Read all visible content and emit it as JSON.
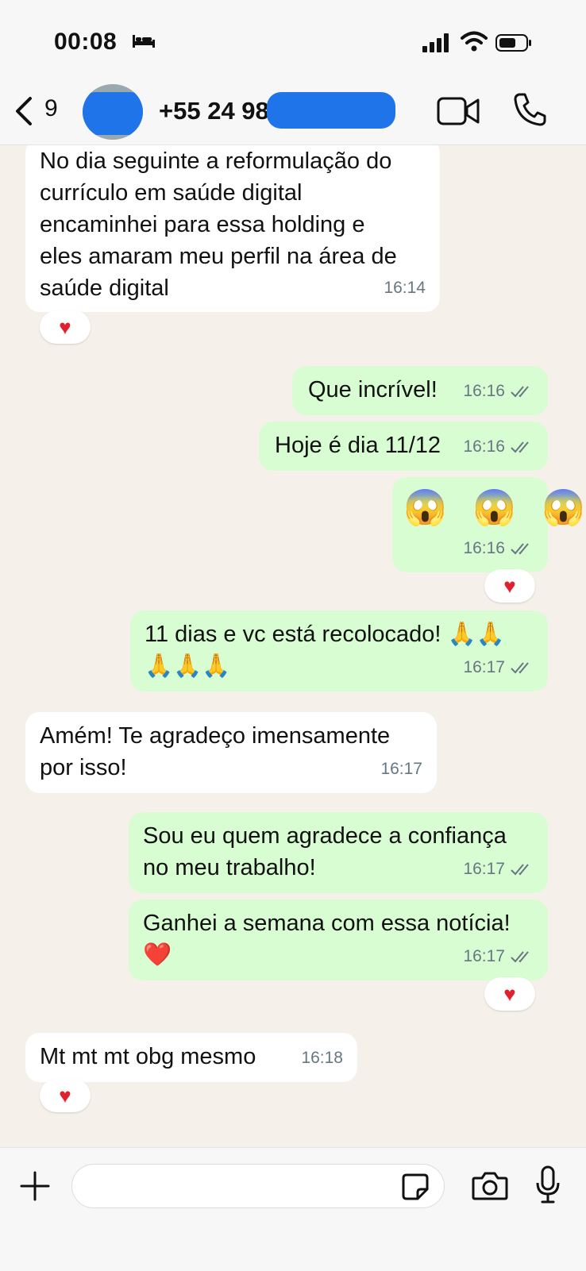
{
  "status_bar": {
    "time": "00:08"
  },
  "header": {
    "unread_count": "9",
    "contact_name": "+55 24 98"
  },
  "messages": [
    {
      "text": "No dia seguinte a reformulação do\ncurrículo em saúde digital\nencaminhei para essa holding e\neles amaram meu perfil na área de\nsaúde digital",
      "time": "16:14",
      "reaction": "♥"
    },
    {
      "text": "Que incrível!",
      "time": "16:16"
    },
    {
      "text": "Hoje é dia 11/12",
      "time": "16:16"
    },
    {
      "text": "😱 😱 😱",
      "time": "16:16",
      "reaction": "♥"
    },
    {
      "text": "11 dias e vc está recolocado! 🙏🙏\n🙏🙏🙏",
      "time": "16:17"
    },
    {
      "text": "Amém! Te agradeço imensamente\npor isso!",
      "time": "16:17"
    },
    {
      "text": "Sou eu quem agradece a confiança\nno meu trabalho!",
      "time": "16:17"
    },
    {
      "text": "Ganhei a semana com essa notícia!\n❤️",
      "time": "16:17",
      "reaction": "♥"
    },
    {
      "text": "Mt mt mt obg mesmo",
      "time": "16:18",
      "reaction": "♥"
    }
  ],
  "composer": {
    "placeholder": ""
  },
  "colors": {
    "outgoing_bubble": "#d9fdd3",
    "incoming_bubble": "#ffffff",
    "background": "#f5f1ea",
    "redaction": "#1e74e8"
  },
  "icons": [
    "bed-icon",
    "signal-icon",
    "wifi-icon",
    "battery-icon",
    "back-chevron-icon",
    "video-call-icon",
    "phone-icon",
    "plus-icon",
    "sticker-icon",
    "camera-icon",
    "microphone-icon",
    "read-ticks-icon",
    "heart-reaction-icon"
  ]
}
